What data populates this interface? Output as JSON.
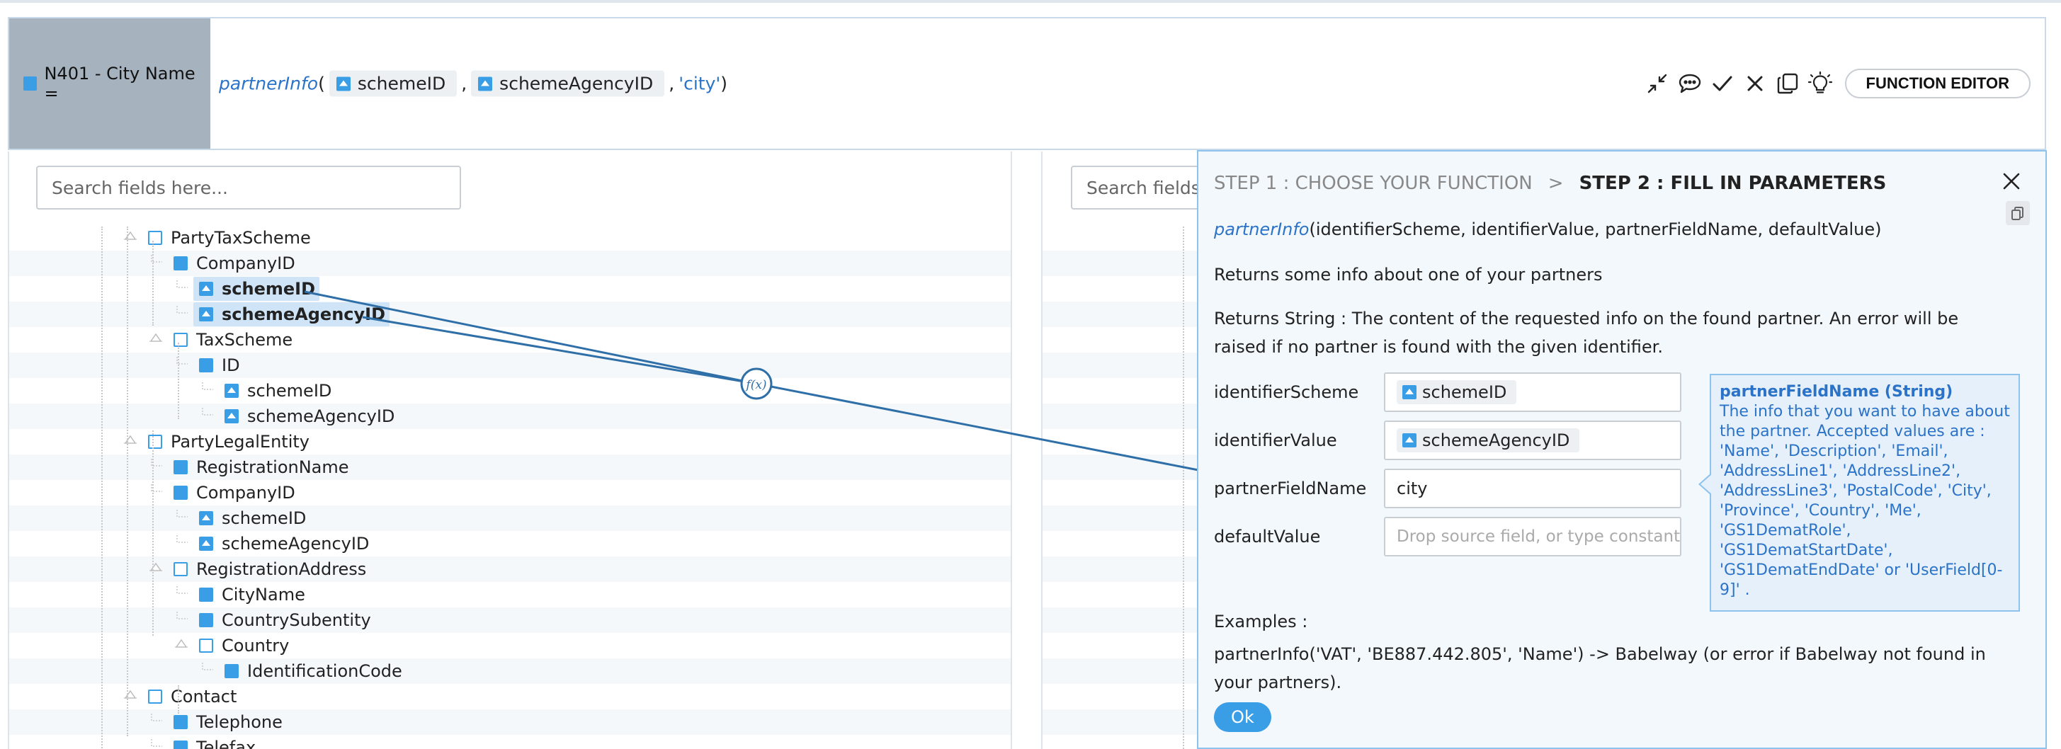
{
  "target": {
    "label": "N401 - City Name ="
  },
  "formula": {
    "function": "partnerInfo",
    "open": "(",
    "arg1": "schemeID",
    "comma1": ",",
    "arg2": "schemeAgencyID",
    "comma2": ",",
    "arg3": "'city'",
    "close": ")"
  },
  "toolbar": {
    "collapse_icon": "collapse-arrows-icon",
    "comment_icon": "speech-bubble-icon",
    "accept_icon": "checkmark-icon",
    "cancel_icon": "x-icon",
    "copy_icon": "copy-icon",
    "hint_icon": "lightbulb-icon",
    "function_editor_label": "FUNCTION EDITOR"
  },
  "left_search": {
    "placeholder": "Search fields here..."
  },
  "right_search": {
    "placeholder": "Search fields here..."
  },
  "tree": [
    {
      "label": "PartyTaxScheme",
      "kind": "group",
      "level": 0
    },
    {
      "label": "CompanyID",
      "kind": "field",
      "level": 1
    },
    {
      "label": "schemeID",
      "kind": "attribute",
      "level": 2,
      "selected": true
    },
    {
      "label": "schemeAgencyID",
      "kind": "attribute",
      "level": 2,
      "selected": true
    },
    {
      "label": "TaxScheme",
      "kind": "group",
      "level": 1
    },
    {
      "label": "ID",
      "kind": "field",
      "level": 2
    },
    {
      "label": "schemeID",
      "kind": "attribute",
      "level": 3
    },
    {
      "label": "schemeAgencyID",
      "kind": "attribute",
      "level": 3
    },
    {
      "label": "PartyLegalEntity",
      "kind": "group",
      "level": 0
    },
    {
      "label": "RegistrationName",
      "kind": "field",
      "level": 1
    },
    {
      "label": "CompanyID",
      "kind": "field",
      "level": 1
    },
    {
      "label": "schemeID",
      "kind": "attribute",
      "level": 2
    },
    {
      "label": "schemeAgencyID",
      "kind": "attribute",
      "level": 2
    },
    {
      "label": "RegistrationAddress",
      "kind": "group",
      "level": 1
    },
    {
      "label": "CityName",
      "kind": "field",
      "level": 2
    },
    {
      "label": "CountrySubentity",
      "kind": "field",
      "level": 2
    },
    {
      "label": "Country",
      "kind": "group",
      "level": 2
    },
    {
      "label": "IdentificationCode",
      "kind": "field",
      "level": 3
    },
    {
      "label": "Contact",
      "kind": "group",
      "level": 0
    },
    {
      "label": "Telephone",
      "kind": "field",
      "level": 1
    },
    {
      "label": "Telefax",
      "kind": "field",
      "level": 1
    }
  ],
  "dialog": {
    "step1": "STEP 1 : CHOOSE YOUR FUNCTION",
    "separator": ">",
    "step2": "STEP 2 : FILL IN PARAMETERS",
    "signature_fn": "partnerInfo",
    "signature_params": "(identifierScheme, identifierValue, partnerFieldName, defaultValue)",
    "description": "Returns some info about one of your partners",
    "returns": "Returns String : The content of the requested info on the found partner. An error will be raised if no partner is found with the given identifier.",
    "params": [
      {
        "label": "identifierScheme",
        "chip": "schemeID",
        "value": "",
        "placeholder": ""
      },
      {
        "label": "identifierValue",
        "chip": "schemeAgencyID",
        "value": "",
        "placeholder": ""
      },
      {
        "label": "partnerFieldName",
        "chip": "",
        "value": "city",
        "placeholder": ""
      },
      {
        "label": "defaultValue",
        "chip": "",
        "value": "",
        "placeholder": "Drop source field, or type constant..."
      }
    ],
    "tooltip_title": "partnerFieldName (String)",
    "tooltip_body": "The info that you want to have about the partner. Accepted values are : 'Name', 'Description', 'Email', 'AddressLine1', 'AddressLine2', 'AddressLine3', 'PostalCode', 'City', 'Province', 'Country', 'Me', 'GS1DematRole', 'GS1DematStartDate', 'GS1DematEndDate' or 'UserField[0-9]' .",
    "examples_heading": "Examples :",
    "examples_text": "partnerInfo('VAT', 'BE887.442.805', 'Name') -> Babelway (or error if Babelway not found in your partners).",
    "ok_label": "Ok",
    "mapping_node_label": "f(x)"
  },
  "colors": {
    "accent": "#3a9ee6",
    "link_line": "#2f6fa8",
    "selected_row": "#cfe4f6",
    "target_bg": "#a6b2bd"
  }
}
